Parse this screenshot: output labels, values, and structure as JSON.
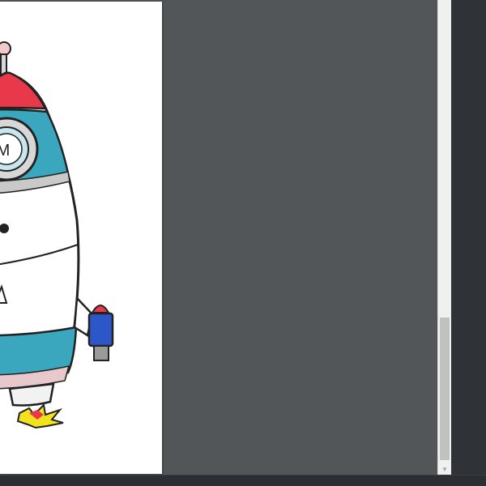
{
  "viewer": {
    "page_image": "rocket-illustration",
    "rocket_window_letter": "M"
  },
  "scrollbar": {
    "down_arrow_icon": "chevron-down-icon",
    "scroll_position": 0.67
  },
  "colors": {
    "workspace": "#525659",
    "page": "#ffffff",
    "frame": "#2b2e33",
    "rocket_red": "#e8394a",
    "rocket_teal": "#3ba7bf",
    "rocket_blue": "#2d57c8",
    "flame_yellow": "#f4e31c"
  }
}
